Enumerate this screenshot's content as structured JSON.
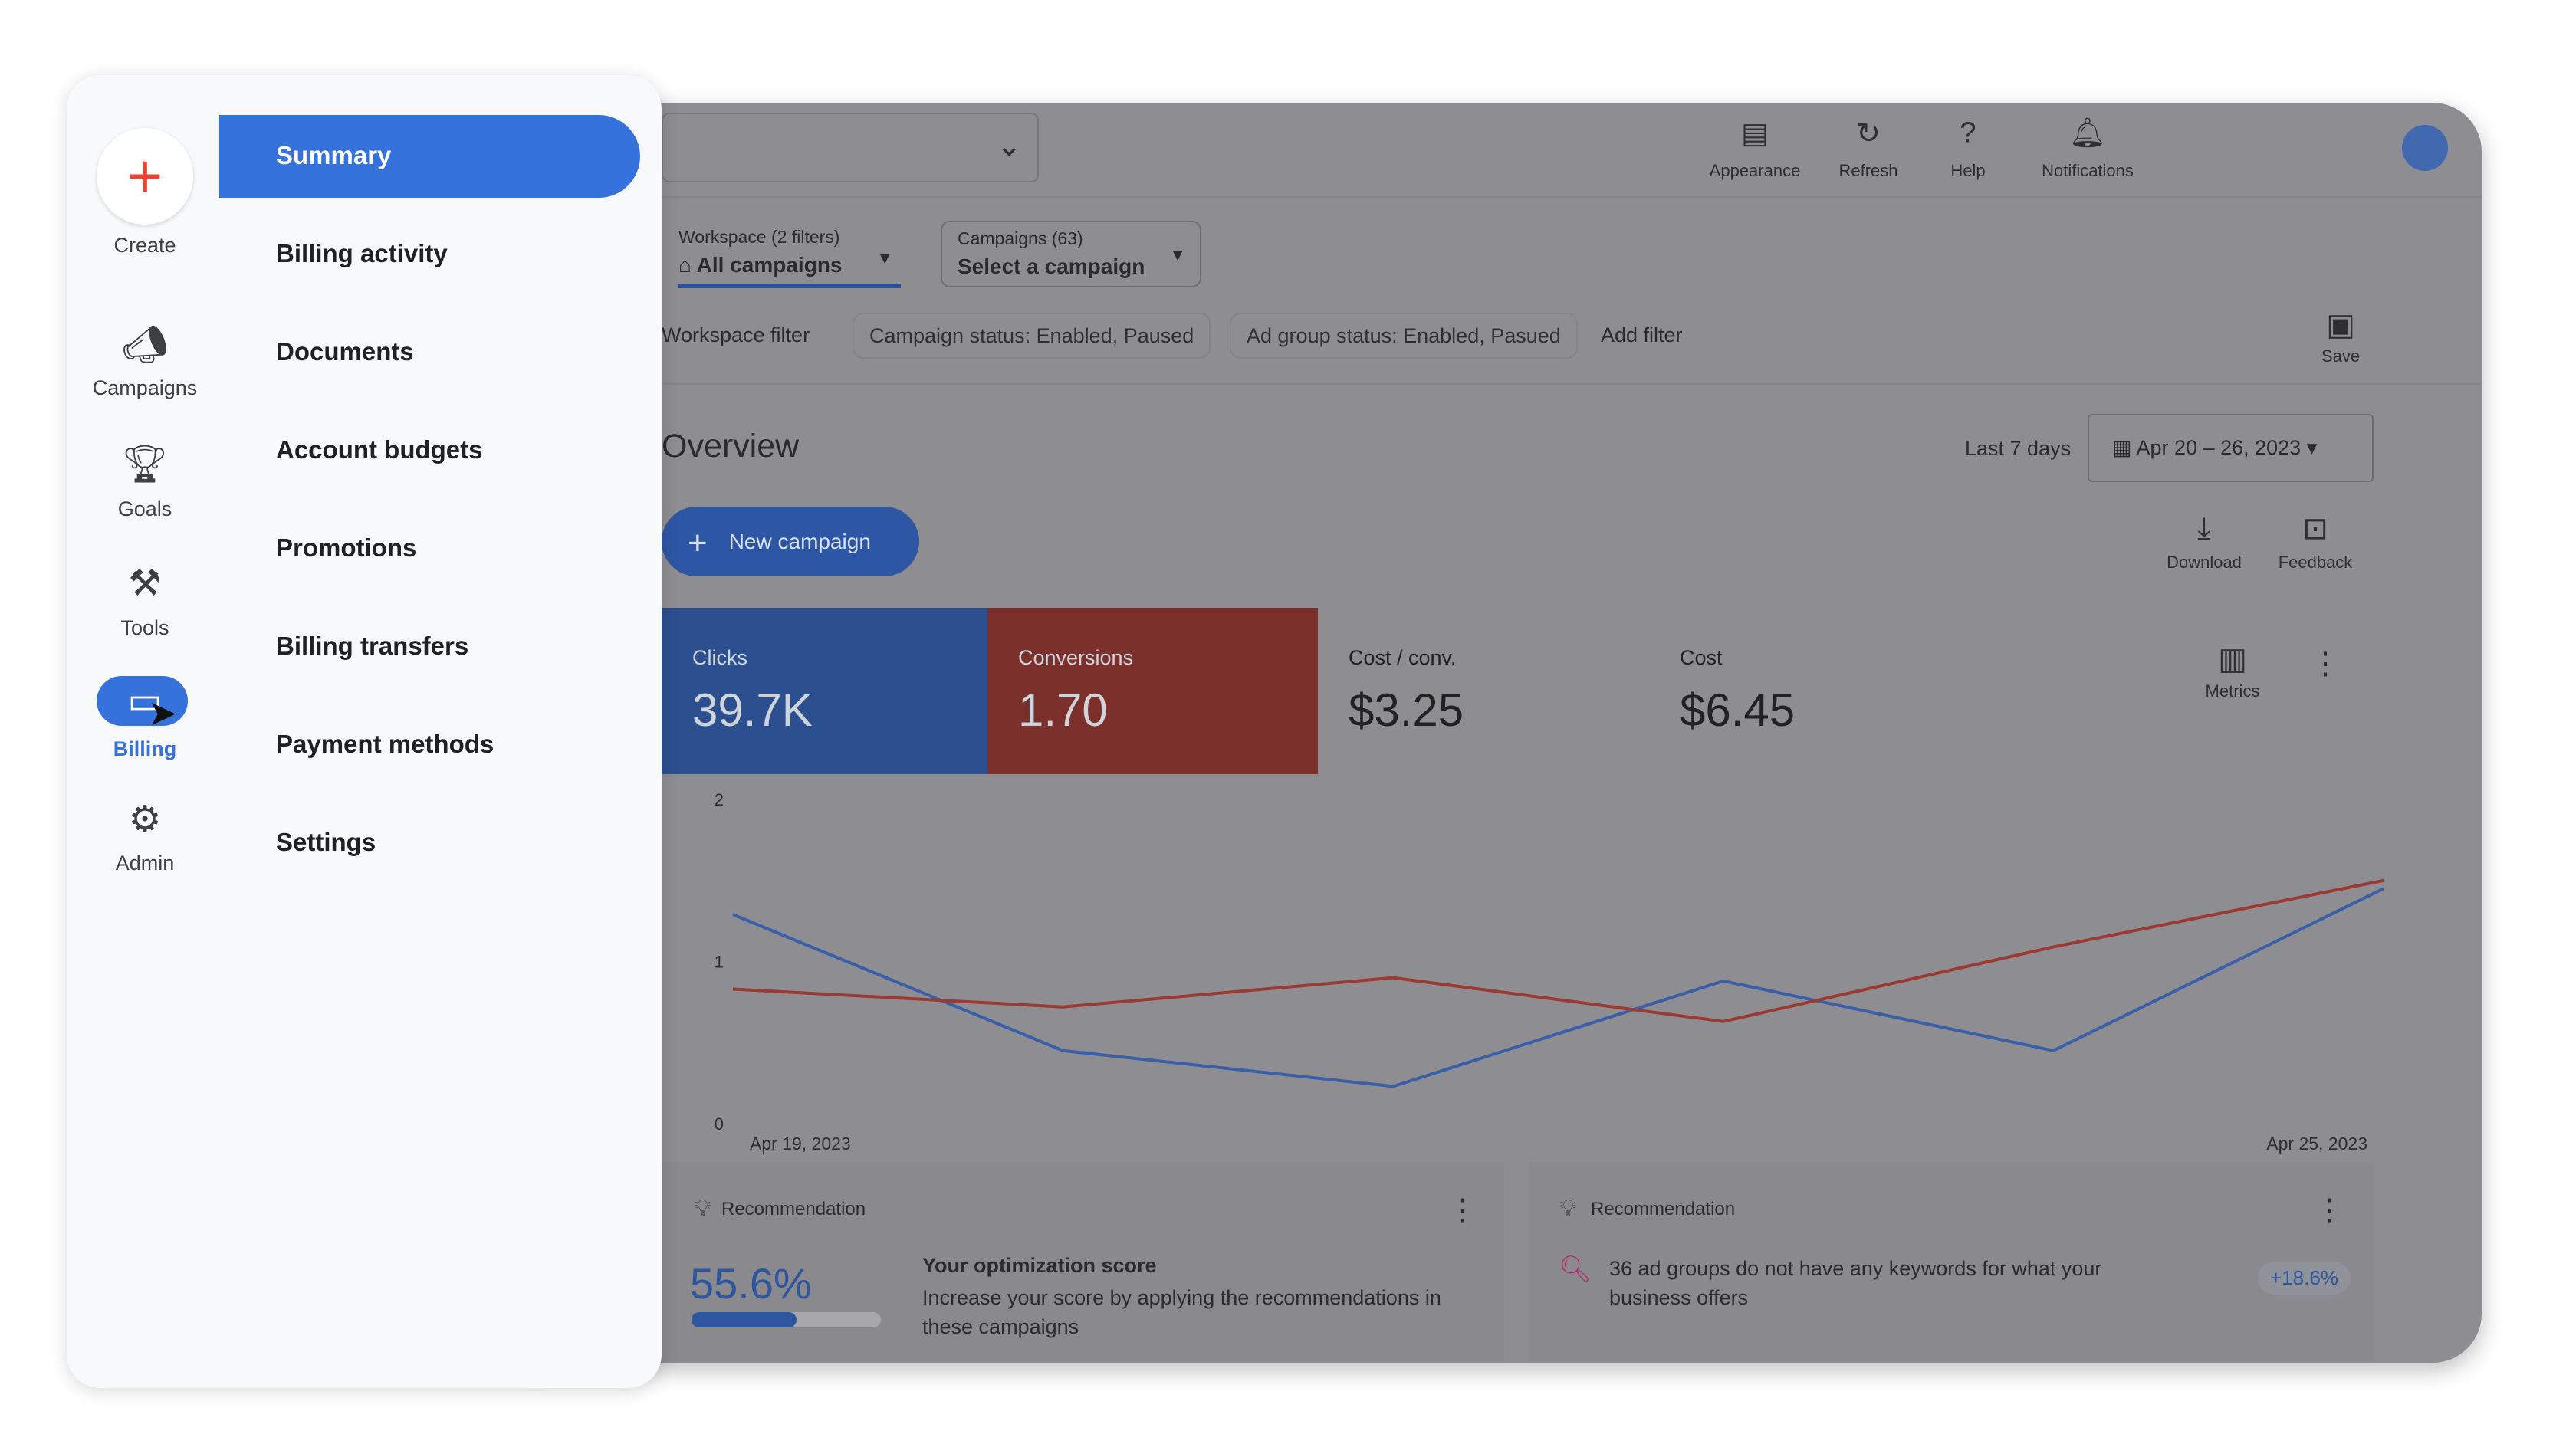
{
  "panel": {
    "rail": [
      {
        "label": "Create",
        "icon": "plus-icon"
      },
      {
        "label": "Campaigns",
        "icon": "megaphone-icon"
      },
      {
        "label": "Goals",
        "icon": "trophy-icon"
      },
      {
        "label": "Tools",
        "icon": "tools-icon"
      },
      {
        "label": "Billing",
        "icon": "billing-icon",
        "active": true
      },
      {
        "label": "Admin",
        "icon": "gear-icon"
      }
    ],
    "menu": [
      "Summary",
      "Billing activity",
      "Documents",
      "Account budgets",
      "Promotions",
      "Billing transfers",
      "Payment methods",
      "Settings"
    ],
    "active_menu": "Summary"
  },
  "topbar": {
    "actions": [
      {
        "label": "Appearance",
        "icon": "appearance-icon"
      },
      {
        "label": "Refresh",
        "icon": "refresh-icon"
      },
      {
        "label": "Help",
        "icon": "help-icon"
      },
      {
        "label": "Notifications",
        "icon": "bell-icon"
      }
    ]
  },
  "filters": {
    "workspace_label": "Workspace (2 filters)",
    "workspace_value": "All campaigns",
    "campaigns_label": "Campaigns (63)",
    "campaigns_value": "Select a campaign",
    "workspace_filter": "Workspace filter",
    "chips": [
      "Campaign status: Enabled, Paused",
      "Ad group status: Enabled, Pasued"
    ],
    "add_filter": "Add filter",
    "save": "Save"
  },
  "overview": {
    "title": "Overview",
    "range_label": "Last 7 days",
    "date_range": "Apr 20 – 26, 2023",
    "new_campaign": "New campaign",
    "download": "Download",
    "feedback": "Feedback",
    "metrics_button": "Metrics",
    "metrics": [
      {
        "label": "Clicks",
        "value": "39.7K",
        "color": "#2c4f8f"
      },
      {
        "label": "Conversions",
        "value": "1.70",
        "color": "#7b302c"
      },
      {
        "label": "Cost / conv.",
        "value": "$3.25"
      },
      {
        "label": "Cost",
        "value": "$6.45"
      }
    ]
  },
  "chart_data": {
    "type": "line",
    "y_ticks": [
      "0",
      "1",
      "2"
    ],
    "ylim": [
      0,
      2
    ],
    "x_labels": [
      "Apr 19, 2023",
      "Apr 25, 2023"
    ],
    "grid": false,
    "series": [
      {
        "color": "#3a5fa8",
        "values": [
          1.29,
          0.45,
          0.23,
          0.88,
          0.45,
          1.45
        ]
      },
      {
        "color": "#9a3a32",
        "values": [
          0.83,
          0.72,
          0.9,
          0.63,
          1.09,
          1.5
        ]
      }
    ]
  },
  "recommendations": [
    {
      "label": "Recommendation",
      "score": "55.6%",
      "score_value": 55.6,
      "title": "Your optimization score",
      "desc": "Increase your score by applying the recommendations in these campaigns"
    },
    {
      "label": "Recommendation",
      "text": "36 ad groups do not have any keywords for what your business offers",
      "badge": "+18.6%"
    }
  ]
}
